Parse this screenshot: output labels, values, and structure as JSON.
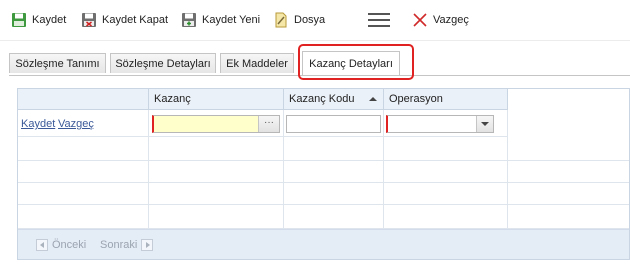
{
  "toolbar": {
    "save": {
      "label": "Kaydet",
      "icon": "save-icon"
    },
    "save_close": {
      "label": "Kaydet Kapat",
      "icon": "save-close-icon"
    },
    "save_new": {
      "label": "Kaydet Yeni",
      "icon": "save-new-icon"
    },
    "file": {
      "label": "Dosya",
      "icon": "file-icon"
    },
    "menu_icon": "hamburger-menu-icon",
    "cancel": {
      "label": "Vazgeç",
      "icon": "x-icon"
    }
  },
  "tabs": [
    {
      "label": "Sözleşme Tanımı",
      "active": false
    },
    {
      "label": "Sözleşme Detayları",
      "active": false
    },
    {
      "label": "Ek Maddeler",
      "active": false
    },
    {
      "label": "Kazanç Detayları",
      "active": true
    }
  ],
  "grid": {
    "columns": [
      {
        "label": ""
      },
      {
        "label": "Kazanç"
      },
      {
        "label": "Kazanç Kodu",
        "sorted": "asc"
      },
      {
        "label": "Operasyon"
      }
    ],
    "edit_row": {
      "save_link": "Kaydet",
      "cancel_link": "Vazgeç",
      "kazanc_value": "",
      "kazanc_kodu_value": "",
      "operasyon_value": ""
    },
    "empty_rows": 4
  },
  "pager": {
    "prev_label": "Önceki",
    "next_label": "Sonraki"
  },
  "colors": {
    "highlight": "#e02222",
    "required_marker": "#e02222",
    "link": "#3b5998",
    "grid_header_bg": "#ebf1f8",
    "pager_bg": "#e4ecf6"
  }
}
